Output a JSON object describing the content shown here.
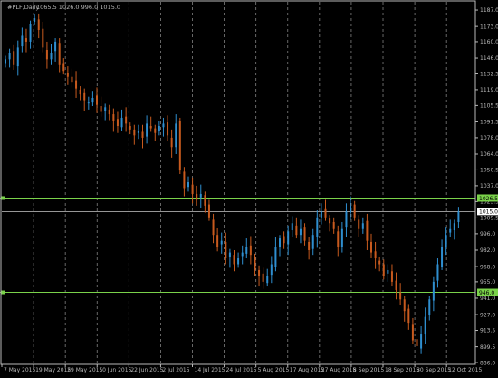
{
  "window": {
    "symbol_label": "#PLF,Daily",
    "ohlc_text": "1065.5 1026.0 996.0 1015.0"
  },
  "colors": {
    "background": "#000000",
    "frame": "#b9b9b9",
    "text": "#b9b9b9",
    "grid": "#808080",
    "bull": "#2f8fd0",
    "bear": "#c85a1e",
    "level_line": "#7ad24a",
    "price_line": "#c8c8c8",
    "level_badge_bg": "#7ad24a",
    "level_badge_text": "#000000",
    "price_badge_bg": "#ffffff",
    "price_badge_text": "#000000"
  },
  "chart_data": {
    "type": "candlestick",
    "title": "#PLF,Daily",
    "ohlc_readout": "1065.5 1026.0 996.0 1015.0",
    "ylim": [
      884.5,
      1194.0
    ],
    "y_ticks": [
      "1187.0",
      "1173.0",
      "1160.0",
      "1146.0",
      "1132.5",
      "1119.0",
      "1105.5",
      "1091.5",
      "1078.0",
      "1064.0",
      "1050.5",
      "1037.0",
      "1023.5",
      "1009.5",
      "996.0",
      "982.0",
      "968.0",
      "955.0",
      "941.0",
      "927.0",
      "913.5",
      "899.5",
      "886.0"
    ],
    "x_ticks": [
      "7 May 2015",
      "19 May 2015",
      "29 May 2015",
      "10 Jun 2015",
      "22 Jun 2015",
      "2 Jul 2015",
      "14 Jul 2015",
      "24 Jul 2015",
      "5 Aug 2015",
      "17 Aug 2015",
      "27 Aug 2015",
      "8 Sep 2015",
      "18 Sep 2015",
      "30 Sep 2015",
      "12 Oct 2015"
    ],
    "grid": "vertical-dashed",
    "level_lines": [
      {
        "label": "1026.5",
        "value": 1026.5
      },
      {
        "label": "946.0",
        "value": 946.0
      }
    ],
    "current_price": {
      "label": "1015.0",
      "value": 1015.0
    },
    "closes": [
      1145,
      1150,
      1140,
      1155,
      1165,
      1160,
      1175,
      1180,
      1170,
      1155,
      1145,
      1150,
      1160,
      1140,
      1135,
      1130,
      1125,
      1120,
      1115,
      1110,
      1108,
      1112,
      1106,
      1100,
      1104,
      1098,
      1092,
      1088,
      1095,
      1090,
      1085,
      1080,
      1084,
      1078,
      1090,
      1086,
      1082,
      1088,
      1090,
      1080,
      1070,
      1090,
      1050,
      1035,
      1040,
      1030,
      1025,
      1030,
      1020,
      1010,
      995,
      985,
      990,
      975,
      980,
      970,
      975,
      980,
      985,
      978,
      965,
      960,
      955,
      960,
      970,
      985,
      992,
      988,
      998,
      1005,
      995,
      1000,
      990,
      982,
      995,
      1010,
      1015,
      1010,
      1005,
      1000,
      985,
      1000,
      1015,
      1020,
      1010,
      1000,
      1005,
      990,
      980,
      975,
      970,
      960,
      965,
      955,
      948,
      940,
      930,
      920,
      905,
      900,
      910,
      925,
      940,
      955,
      970,
      985,
      995,
      1000,
      1005,
      1015
    ]
  }
}
